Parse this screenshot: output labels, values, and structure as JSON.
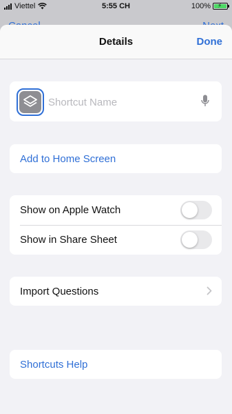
{
  "status_bar": {
    "carrier": "Viettel",
    "time": "5:55 CH",
    "battery": "100%",
    "battery_level": 1.0,
    "battery_color": "#4cd964"
  },
  "under_sheet": {
    "left_label": "Cancel",
    "right_label": "Next"
  },
  "nav": {
    "title": "Details",
    "done_label": "Done"
  },
  "name_field": {
    "placeholder": "Shortcut Name",
    "value": ""
  },
  "add_home": {
    "label": "Add to Home Screen"
  },
  "toggles": [
    {
      "label": "Show on Apple Watch",
      "on": false
    },
    {
      "label": "Show in Share Sheet",
      "on": false
    }
  ],
  "import_questions": {
    "label": "Import Questions"
  },
  "help": {
    "label": "Shortcuts Help"
  },
  "colors": {
    "accent": "#2f6fd6",
    "background": "#f2f2f6",
    "card": "#ffffff"
  },
  "icons": [
    "wifi-icon",
    "battery-icon",
    "shortcuts-app-icon",
    "microphone-icon",
    "chevron-right-icon"
  ]
}
